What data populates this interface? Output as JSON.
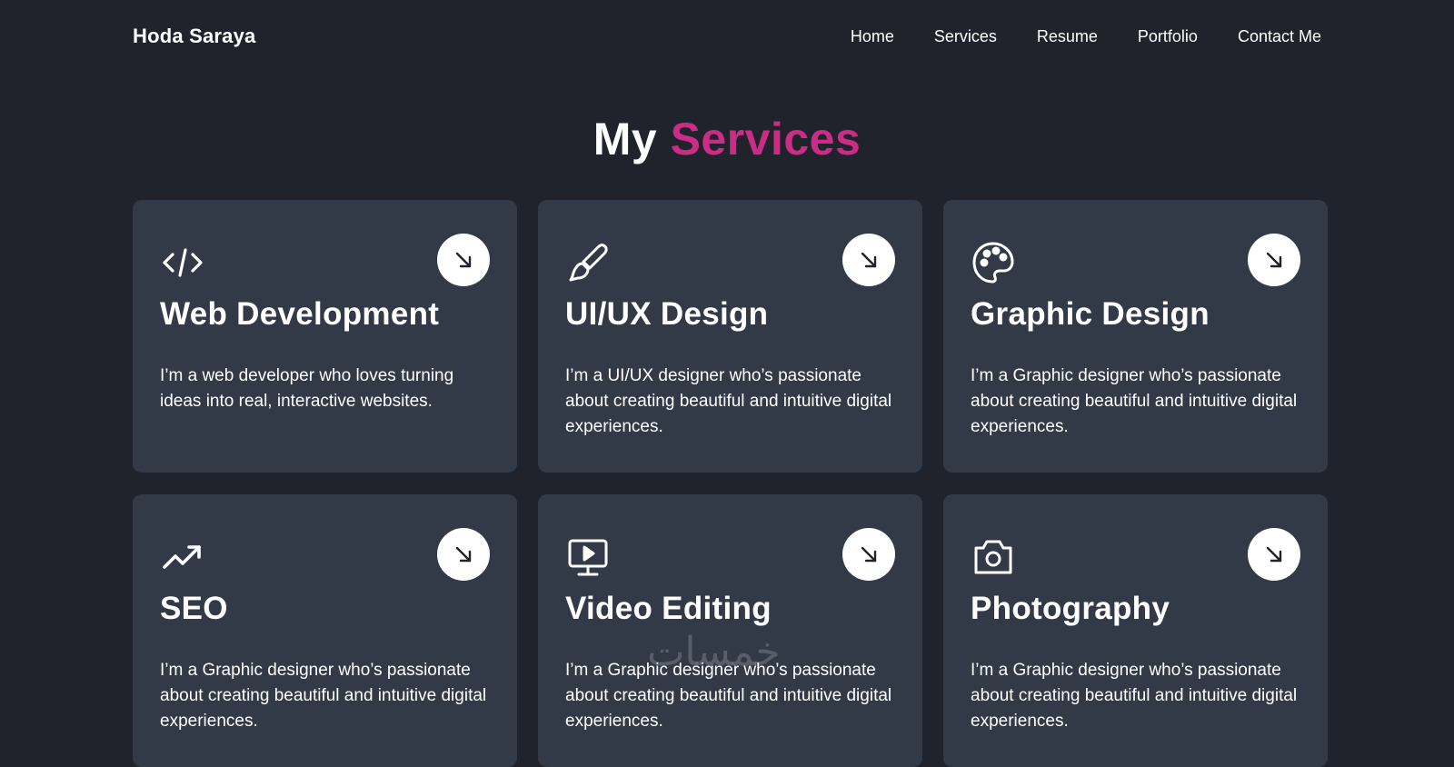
{
  "header": {
    "brand": "Hoda Saraya",
    "nav": [
      "Home",
      "Services",
      "Resume",
      "Portfolio",
      "Contact Me"
    ]
  },
  "section": {
    "title_prefix": "My",
    "title_accent": "Services",
    "accent_color": "#c92d85"
  },
  "cards": [
    {
      "icon": "code-icon",
      "title": "Web Development",
      "desc": "I’m a web developer who loves turning ideas into real, interactive websites."
    },
    {
      "icon": "brush-icon",
      "title": "UI/UX Design",
      "desc": "I’m a UI/UX designer who’s passionate about creating beautiful and intuitive digital experiences."
    },
    {
      "icon": "palette-icon",
      "title": "Graphic Design",
      "desc": "I’m a Graphic designer who’s passionate about creating beautiful and intuitive digital experiences."
    },
    {
      "icon": "trending-up-icon",
      "title": "SEO",
      "desc": "I’m a Graphic designer who’s passionate about creating beautiful and intuitive digital experiences."
    },
    {
      "icon": "video-icon",
      "title": "Video Editing",
      "desc": "I’m a Graphic designer who’s passionate about creating beautiful and intuitive digital experiences."
    },
    {
      "icon": "camera-icon",
      "title": "Photography",
      "desc": "I’m a Graphic designer who’s passionate about creating beautiful and intuitive digital experiences."
    }
  ],
  "watermark": "خمسات"
}
